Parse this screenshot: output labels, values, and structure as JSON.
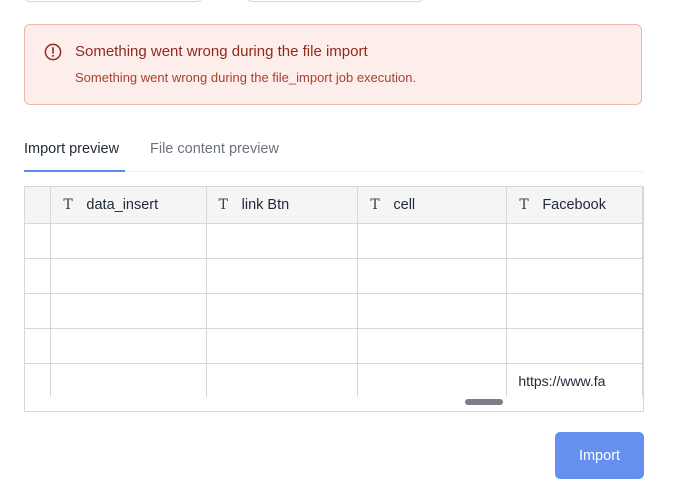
{
  "alert": {
    "icon": "alert-circle-icon",
    "title": "Something went wrong during the file import",
    "message": "Something went wrong during the file_import job execution.",
    "colors": {
      "background": "#fdeeec",
      "border": "#f1b6ad",
      "title": "#8f2a1c"
    }
  },
  "tabs": [
    {
      "label": "Import preview",
      "active": true
    },
    {
      "label": "File content preview",
      "active": false
    }
  ],
  "table": {
    "column_icon": "T",
    "columns": [
      "data_insert",
      "link Btn",
      "cell",
      "Facebook"
    ],
    "rows": [
      [
        "",
        "",
        "",
        ""
      ],
      [
        "",
        "",
        "",
        ""
      ],
      [
        "",
        "",
        "",
        ""
      ],
      [
        "",
        "",
        "",
        ""
      ],
      [
        "",
        "",
        "",
        "https://www.fa"
      ]
    ]
  },
  "import_button": {
    "label": "Import",
    "color": "#6690ef"
  }
}
